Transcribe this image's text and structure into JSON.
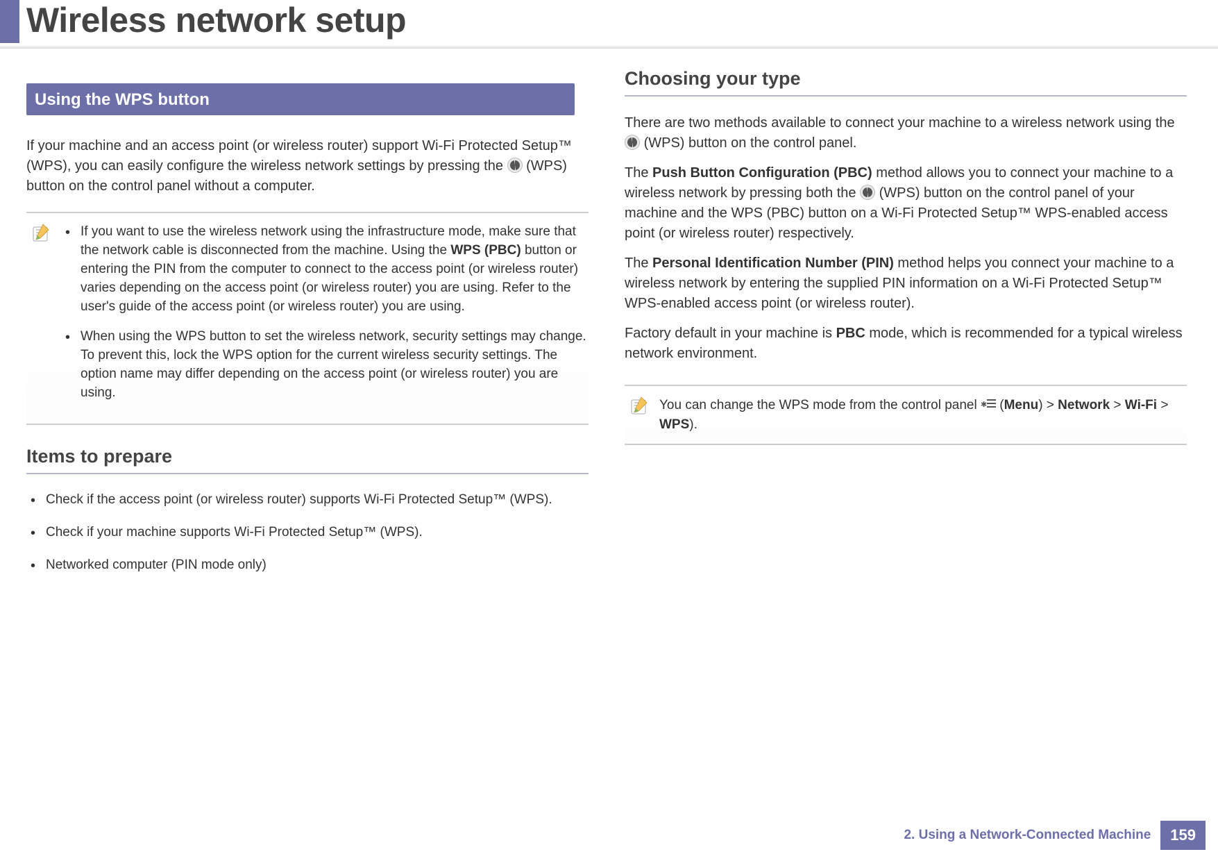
{
  "header": {
    "title": "Wireless network setup"
  },
  "left": {
    "section_bar": "Using the WPS button",
    "intro_a": "If your machine and an access point (or wireless router) support Wi-Fi Protected Setup™ (WPS), you can easily configure the wireless network settings by pressing the ",
    "intro_b": "(WPS) button on the control panel without a computer.",
    "note1_a": "If you want to use the wireless network using the infrastructure mode, make sure that the network cable is disconnected from the machine. Using the ",
    "note1_bold": "WPS (PBC)",
    "note1_b": " button or entering the PIN from the computer to connect to the access point (or wireless router) varies depending on the access point (or wireless router) you are using. Refer to the user's guide of the access point (or wireless router) you are using.",
    "note2": "When using the WPS button to set the wireless network, security settings may change. To prevent this, lock the WPS option for the current wireless security settings. The option name may differ depending on the access point (or wireless router) you are using.",
    "subhead_prepare": "Items to prepare",
    "prepare_1": "Check if the access point (or wireless router) supports Wi-Fi Protected Setup™ (WPS).",
    "prepare_2": "Check if your machine supports Wi-Fi Protected Setup™ (WPS).",
    "prepare_3": "Networked computer (PIN mode only)"
  },
  "right": {
    "subhead_choose": "Choosing your type",
    "intro_a": "There are two methods available to connect your machine to a wireless network using the ",
    "intro_b": " (WPS) button on the control panel.",
    "pbc_a": "The ",
    "pbc_bold": "Push Button Configuration (PBC)",
    "pbc_b": " method allows you to connect your machine to a wireless network by pressing both the ",
    "pbc_c": " (WPS) button on the control panel of your machine and the WPS (PBC) button on a Wi-Fi Protected Setup™ WPS-enabled access point (or wireless router) respectively.",
    "pin_a": "The ",
    "pin_bold": "Personal Identification Number (PIN)",
    "pin_b": " method helps you connect your machine to a wireless network by entering the supplied PIN information on a Wi-Fi Protected Setup™ WPS-enabled access point (or wireless router).",
    "default_a": "Factory default in your machine is ",
    "default_bold": "PBC",
    "default_b": " mode, which is recommended for a typical wireless network environment.",
    "note_a": "You can change the WPS mode from the control panel ",
    "note_menu": "Menu",
    "note_sep1": " > ",
    "note_net": "Network",
    "note_sep2": " > ",
    "note_wifi": "Wi-Fi",
    "note_sep3": " > ",
    "note_wps": "WPS",
    "note_end": ")."
  },
  "footer": {
    "chapter": "2.  Using a Network-Connected Machine",
    "page": "159"
  }
}
